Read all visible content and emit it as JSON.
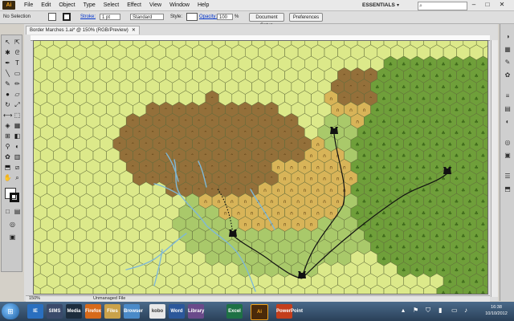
{
  "menubar": {
    "app_logo": "Ai",
    "items": [
      "File",
      "Edit",
      "Object",
      "Type",
      "Select",
      "Effect",
      "View",
      "Window",
      "Help"
    ],
    "workspace": "ESSENTIALS",
    "window_controls": [
      "–",
      "□",
      "✕"
    ]
  },
  "controlbar": {
    "selection": "No Selection",
    "stroke_label": "Stroke:",
    "stroke_value": "1 pt",
    "profile_value": "Standard",
    "style_label": "Style:",
    "opacity_label": "Opacity:",
    "opacity_value": "100",
    "opacity_unit": "%",
    "document_setup": "Document Setup",
    "preferences": "Preferences"
  },
  "document": {
    "tab_title": "Border Marches 1.ai* @ 150% (RGB/Preview)",
    "zoom": "150%",
    "status_text": "Unmanaged File"
  },
  "map": {
    "colors": {
      "plain": "#dce98a",
      "grass": "#a9c96a",
      "forest": "#6f9f3a",
      "hills": "#d8b458",
      "mountains": "#94703a",
      "river": "#7fb8d6",
      "road": "#111111"
    },
    "castles": [
      "castle-north",
      "castle-east",
      "castle-west",
      "castle-south"
    ]
  },
  "taskbar": {
    "apps": [
      "IE",
      "SIMS",
      "Media",
      "Firefox",
      "Files",
      "Browser",
      "kobo",
      "Word",
      "Library",
      "Excel",
      "Ai",
      "PowerPoint"
    ],
    "clock_time": "16:38",
    "clock_date": "10/10/2012"
  }
}
